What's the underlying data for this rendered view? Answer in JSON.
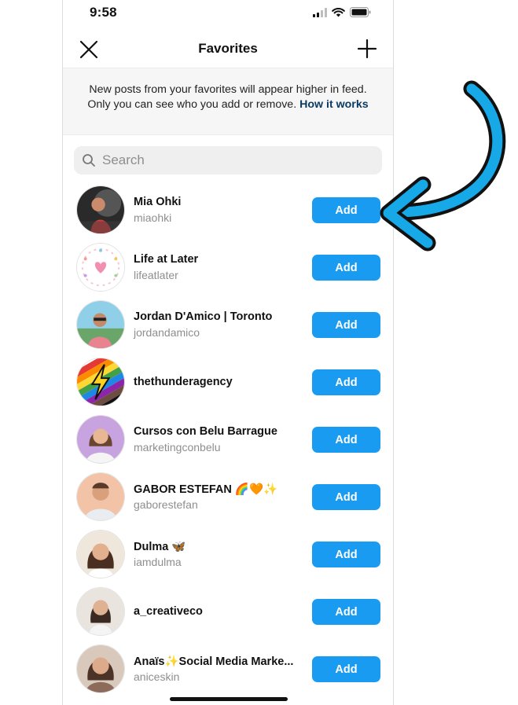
{
  "status_bar": {
    "time": "9:58"
  },
  "nav": {
    "title": "Favorites"
  },
  "notice": {
    "text": "New posts from your favorites will appear higher in feed. Only you can see who you add or remove.",
    "link": "How it works"
  },
  "search": {
    "placeholder": "Search"
  },
  "accounts": [
    {
      "name": "Mia Ohki",
      "handle": "miaohki",
      "button": "Add"
    },
    {
      "name": "Life at Later",
      "handle": "lifeatlater",
      "button": "Add"
    },
    {
      "name": "Jordan D'Amico | Toronto",
      "handle": "jordandamico",
      "button": "Add"
    },
    {
      "name": "thethunderagency",
      "handle": "",
      "button": "Add"
    },
    {
      "name": "Cursos con Belu Barrague",
      "handle": "marketingconbelu",
      "button": "Add"
    },
    {
      "name": "GABOR ESTEFAN 🌈🧡✨",
      "handle": "gaborestefan",
      "button": "Add"
    },
    {
      "name": "Dulma 🦋",
      "handle": "iamdulma",
      "button": "Add"
    },
    {
      "name": "a_creativeco",
      "handle": "",
      "button": "Add"
    },
    {
      "name": "Anaïs✨Social Media Marke...",
      "handle": "aniceskin",
      "button": "Add"
    }
  ],
  "colors": {
    "accent": "#1a9bf2",
    "link": "#0b3a63",
    "annotation_arrow": "#17a8e8"
  },
  "icons": [
    "close-icon",
    "plus-icon",
    "search-icon",
    "signal-icon",
    "wifi-icon",
    "battery-icon",
    "curved-arrow-annotation"
  ]
}
